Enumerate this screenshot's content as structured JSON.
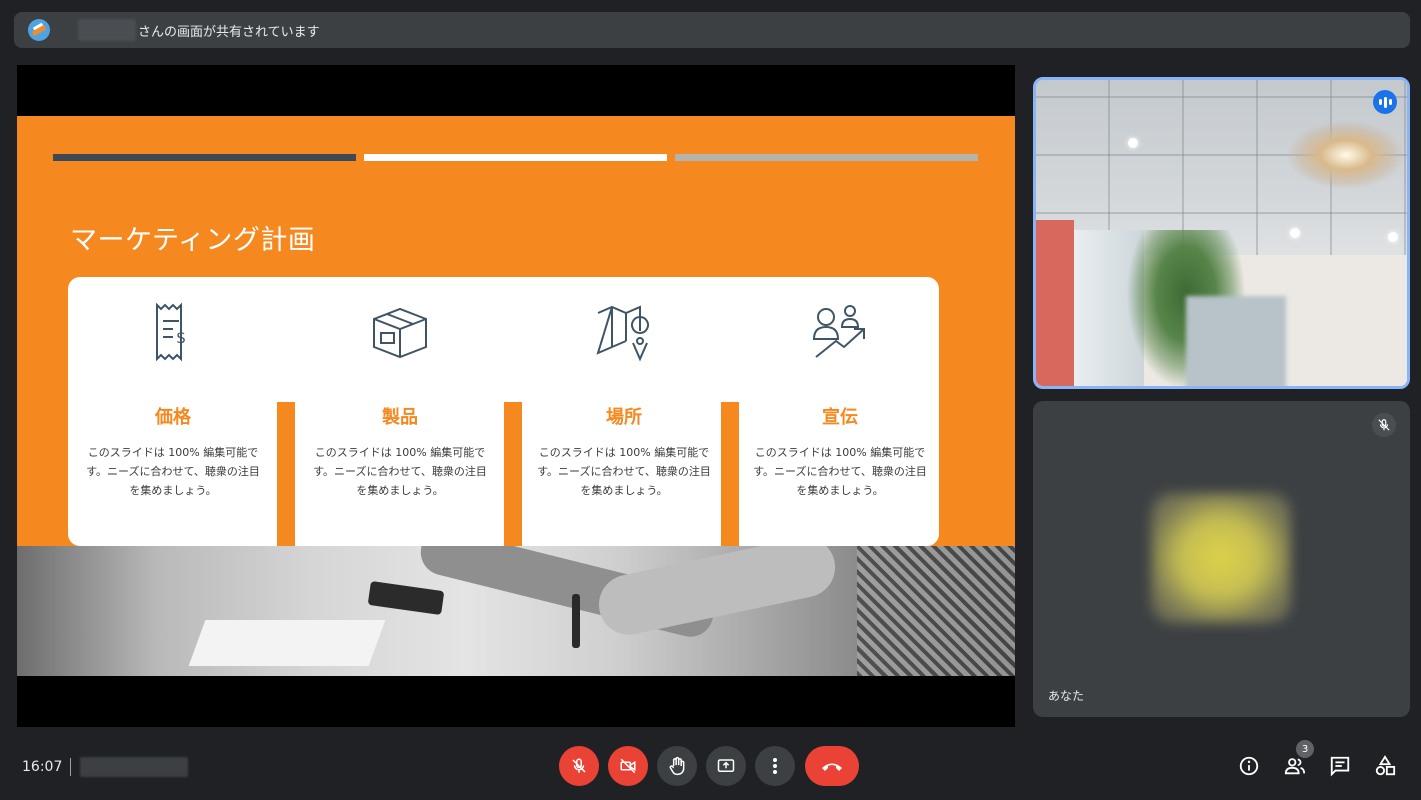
{
  "banner": {
    "text": "さんの画面が共有されています",
    "logo_icon": "slides-app-icon"
  },
  "slide": {
    "title": "マーケティング計画",
    "accent_color": "#f5891f",
    "cards": [
      {
        "icon": "receipt-dollar-icon",
        "heading": "価格",
        "body": "このスライドは 100% 編集可能です。ニーズに合わせて、聴衆の注目を集めましょう。"
      },
      {
        "icon": "box-icon",
        "heading": "製品",
        "body": "このスライドは 100% 編集可能です。ニーズに合わせて、聴衆の注目を集めましょう。"
      },
      {
        "icon": "map-pin-icon",
        "heading": "場所",
        "body": "このスライドは 100% 編集可能です。ニーズに合わせて、聴衆の注目を集めましょう。"
      },
      {
        "icon": "people-growth-icon",
        "heading": "宣伝",
        "body": "このスライドは 100% 編集可能です。ニーズに合わせて、聴衆の注目を集めましょう。"
      }
    ]
  },
  "tiles": {
    "self_name": "あなた",
    "speaking_indicator": "audio-wave-icon",
    "self_muted_icon": "mic-off-icon"
  },
  "bottom_bar": {
    "time": "16:07",
    "controls": [
      {
        "name": "mic-off-button",
        "icon": "mic-off-icon",
        "color": "#ea4335"
      },
      {
        "name": "camera-off-button",
        "icon": "videocam-off-icon",
        "color": "#ea4335"
      },
      {
        "name": "raise-hand-button",
        "icon": "hand-icon",
        "color": "#3c4043"
      },
      {
        "name": "present-button",
        "icon": "present-screen-icon",
        "color": "#3c4043"
      },
      {
        "name": "more-options-button",
        "icon": "more-vert-icon",
        "color": "#3c4043"
      },
      {
        "name": "leave-call-button",
        "icon": "call-end-icon",
        "color": "#ea4335"
      }
    ],
    "people_count": "3",
    "right_icons": [
      "info-icon",
      "people-icon",
      "chat-icon",
      "activities-icon"
    ]
  }
}
